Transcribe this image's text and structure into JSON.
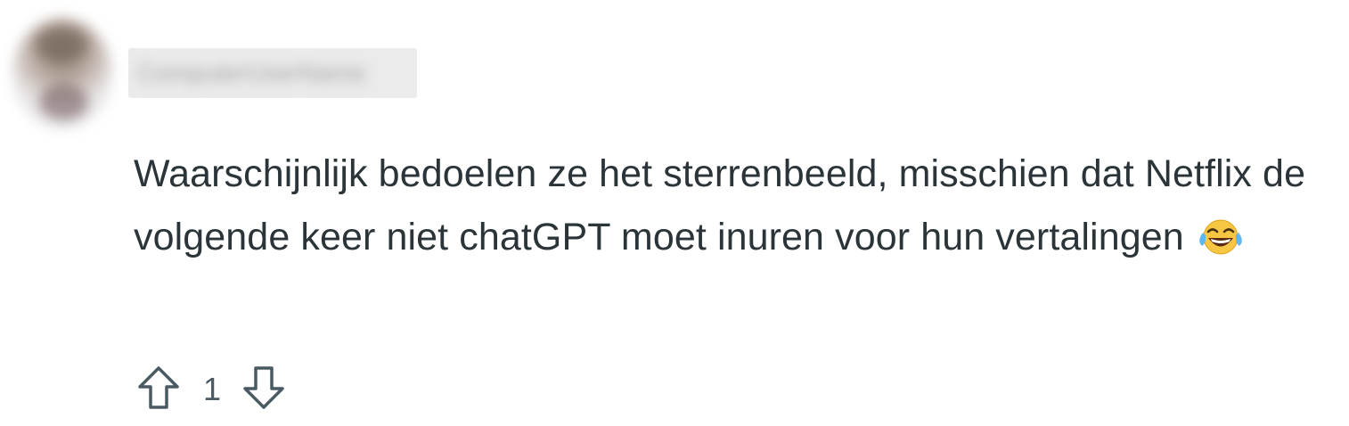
{
  "comment": {
    "author": "ComputerUserName",
    "text": "Waarschijnlijk bedoelen ze het sterrenbeeld, misschien dat Netflix de volgende keer niet chatGPT moet inuren voor hun vertalingen",
    "emoji": "face-with-tears-of-joy",
    "vote_count": "1",
    "colors": {
      "text": "#2a3439",
      "icon": "#4a5a63"
    },
    "icons": {
      "upvote": "arrow-up-outline",
      "downvote": "arrow-down-outline"
    }
  }
}
